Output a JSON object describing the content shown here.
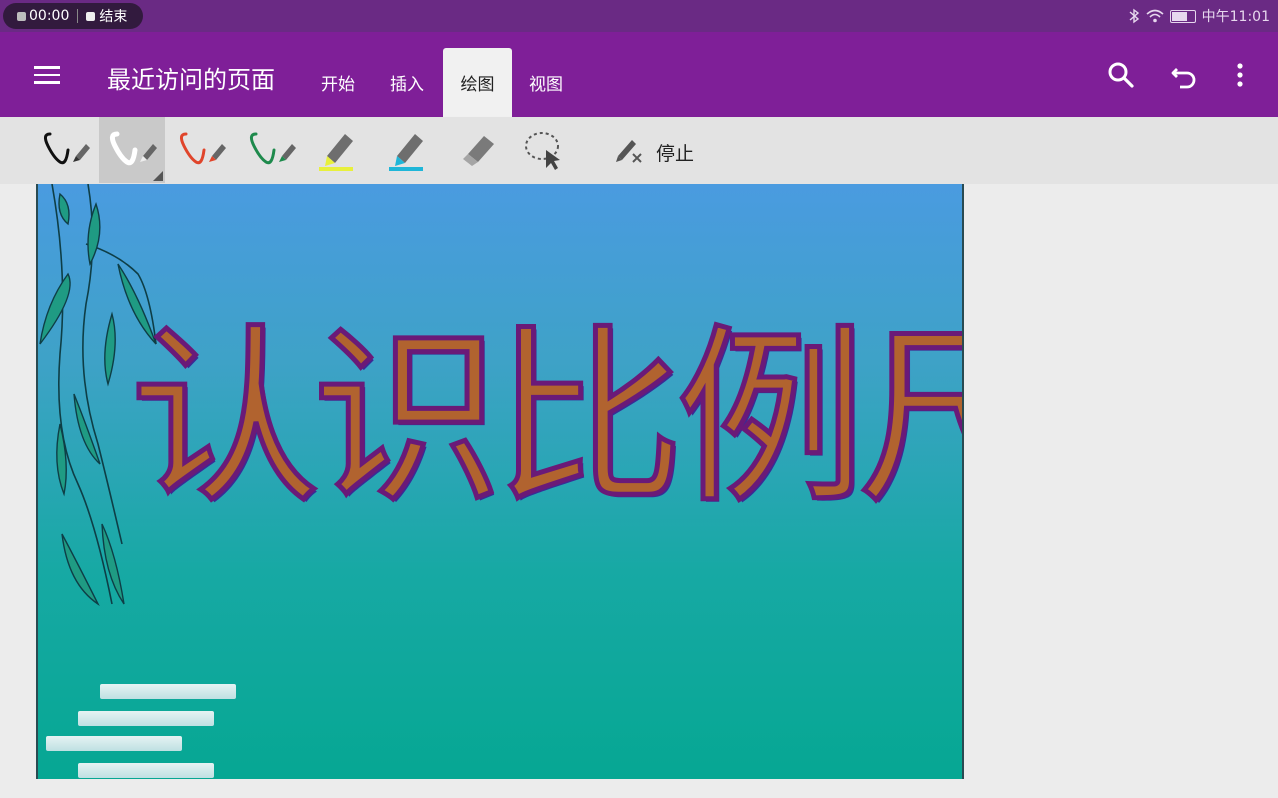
{
  "status_bar": {
    "record_time": "00:00",
    "end_label": "结束",
    "clock": "中午11:01"
  },
  "app_bar": {
    "title": "最近访问的页面",
    "tabs": [
      {
        "label": "开始",
        "active": false
      },
      {
        "label": "插入",
        "active": false
      },
      {
        "label": "绘图",
        "active": true
      },
      {
        "label": "视图",
        "active": false
      }
    ],
    "actions": [
      "search-icon",
      "undo-icon",
      "more-vert-icon"
    ]
  },
  "draw_toolbar": {
    "tools": [
      {
        "name": "pen-black",
        "color": "#111111"
      },
      {
        "name": "pen-white",
        "color": "#ffffff",
        "selected": true
      },
      {
        "name": "pen-red",
        "color": "#e0452b"
      },
      {
        "name": "pen-green",
        "color": "#1e8a4c"
      },
      {
        "name": "highlighter-yellow",
        "color": "#e8f03c"
      },
      {
        "name": "highlighter-cyan",
        "color": "#1fb6d8"
      },
      {
        "name": "eraser",
        "color": "#777777"
      },
      {
        "name": "lasso-select",
        "color": "#555555"
      }
    ],
    "stop_label": "停止"
  },
  "slide": {
    "title": "认识比例尺"
  },
  "colors": {
    "app_bar": "#7f1f98",
    "status_bar": "#6a2a84",
    "ribbon": "#e3e3e3"
  }
}
